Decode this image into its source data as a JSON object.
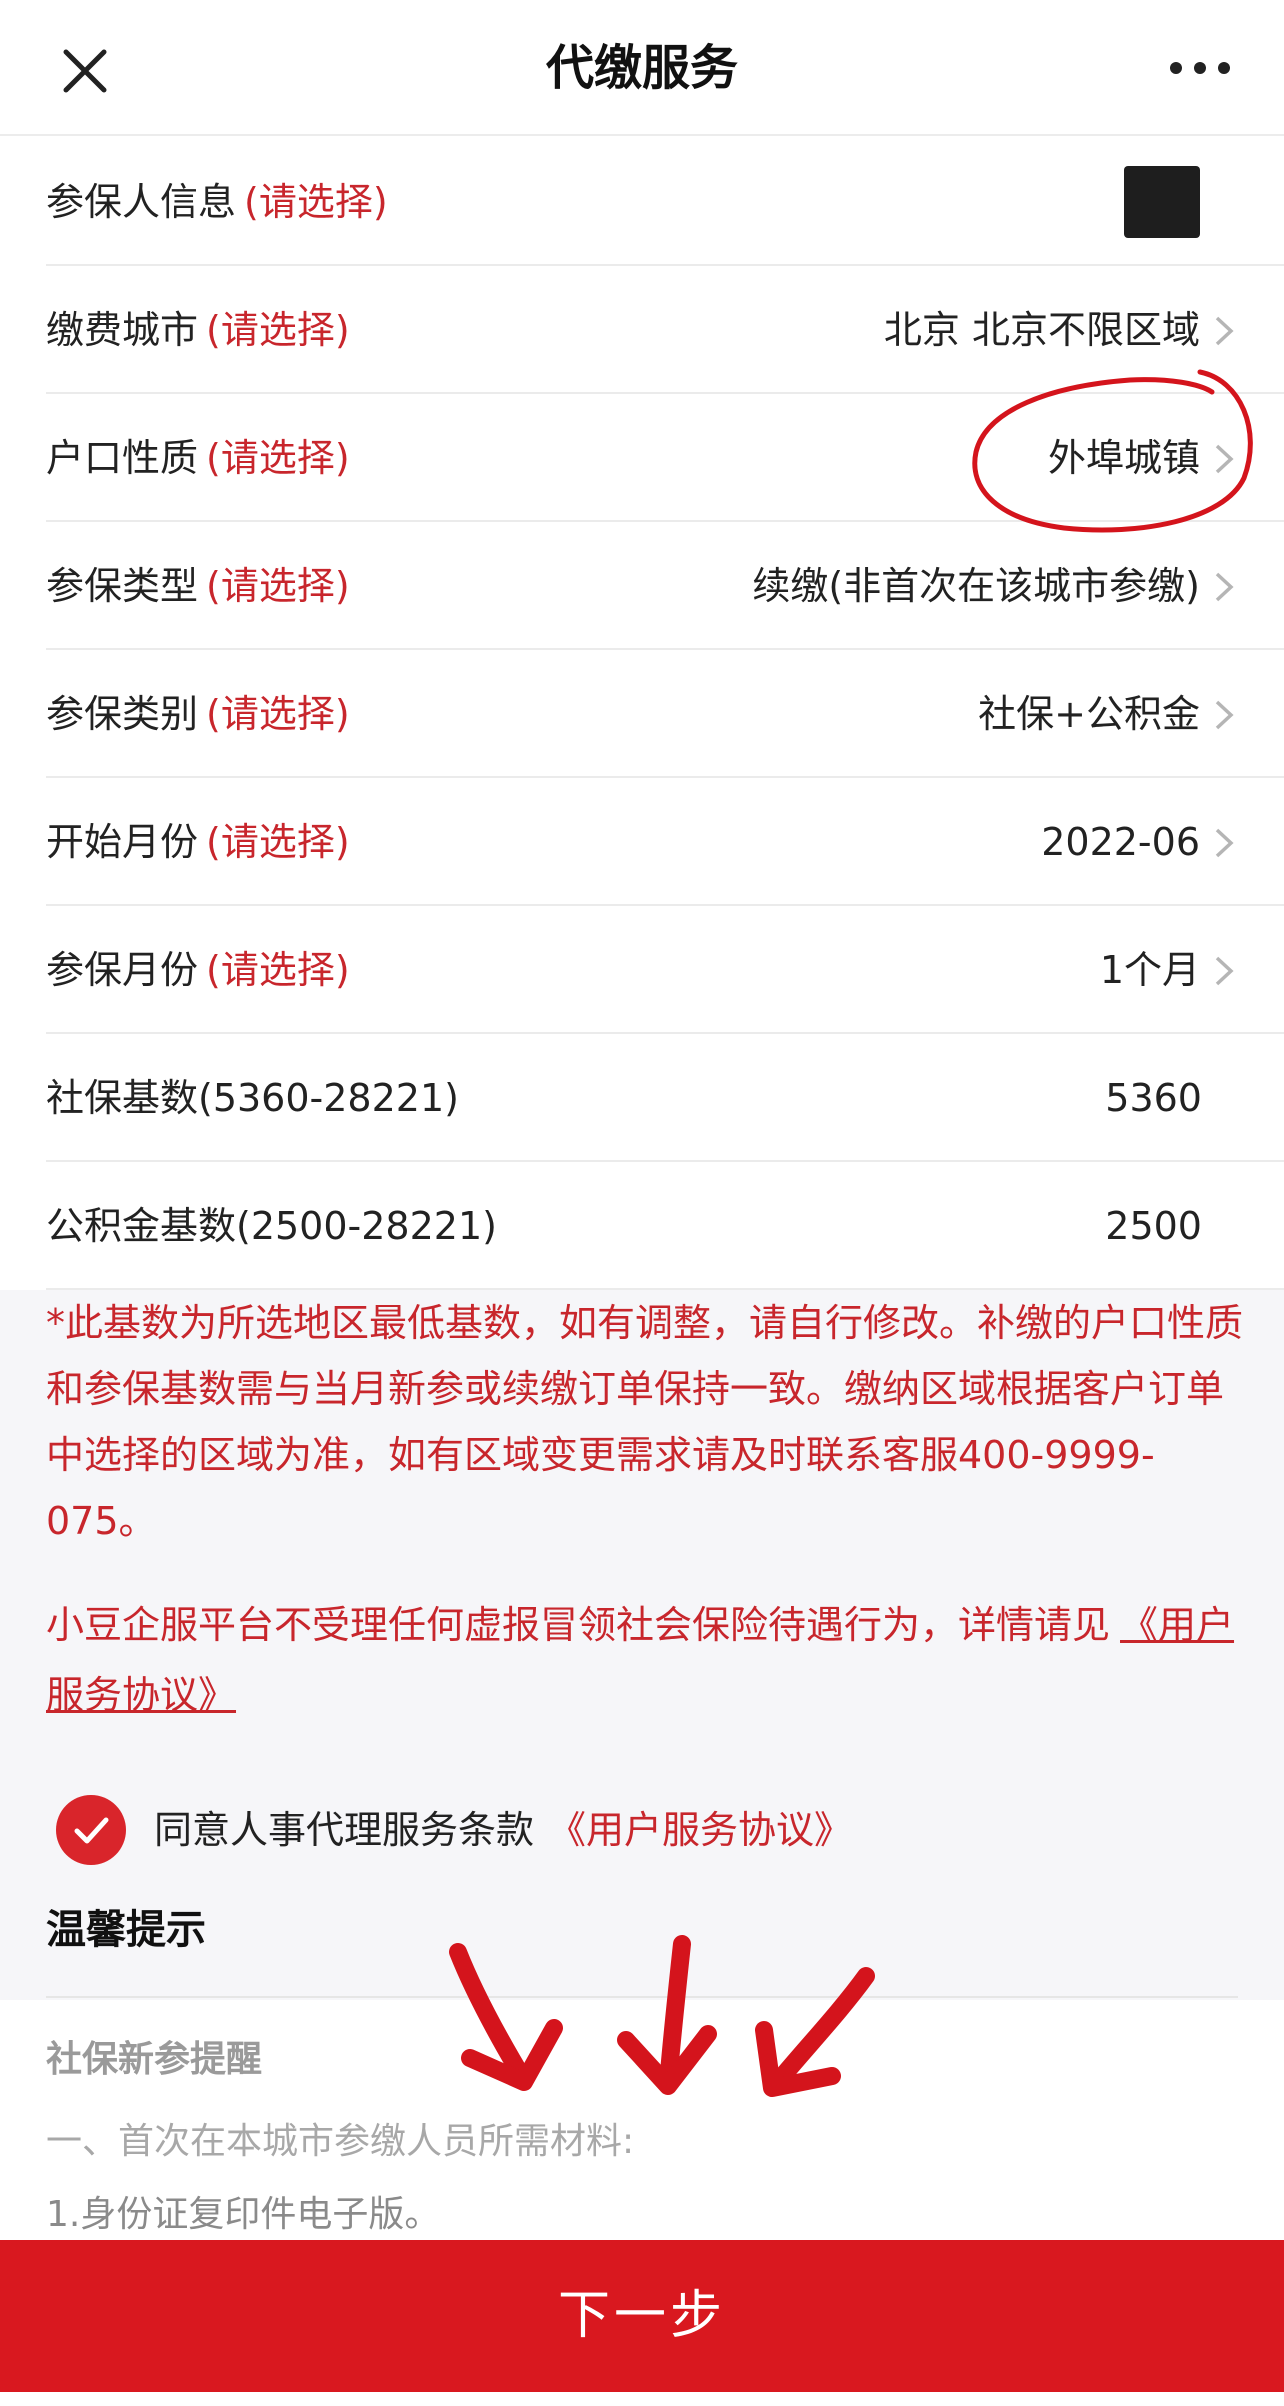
{
  "header": {
    "title": "代缴服务"
  },
  "form": {
    "hint": "(请选择)",
    "rows": [
      {
        "label": "参保人信息",
        "value": ""
      },
      {
        "label": "缴费城市",
        "value": "北京 北京不限区域"
      },
      {
        "label": "户口性质",
        "value": "外埠城镇"
      },
      {
        "label": "参保类型",
        "value": "续缴(非首次在该城市参缴)"
      },
      {
        "label": "参保类别",
        "value": "社保+公积金"
      },
      {
        "label": "开始月份",
        "value": "2022-06"
      },
      {
        "label": "参保月份",
        "value": "1个月"
      },
      {
        "label": "社保基数(5360-28221)",
        "value": "5360"
      },
      {
        "label": "公积金基数(2500-28221)",
        "value": "2500"
      }
    ]
  },
  "notice": {
    "paragraph1": "*此基数为所选地区最低基数，如有调整，请自行修改。补缴的户口性质和参保基数需与当月新参或续缴订单保持一致。缴纳区域根据客户订单中选择的区域为准，如有区域变更需求请及时联系客服400-9999-075。",
    "paragraph2": "小豆企服平台不受理任何虚报冒领社会保险待遇行为，详情请见",
    "paragraph2_link": "《用户服务协议》"
  },
  "agreement": {
    "checked": true,
    "text": "同意人事代理服务条款",
    "link": "《用户服务协议》"
  },
  "tips": {
    "title": "温馨提示",
    "subtitle": "社保新参提醒",
    "line1": "一、首次在本城市参缴人员所需材料:",
    "line2": "1.身份证复印件电子版。"
  },
  "footer": {
    "next_label": "下一步"
  },
  "colors": {
    "accent": "#d9181f",
    "hint": "#c8262c",
    "annotation": "#d4141c"
  },
  "icons": [
    "close-icon",
    "more-icon",
    "chevron-right-icon",
    "checkmark-icon"
  ]
}
